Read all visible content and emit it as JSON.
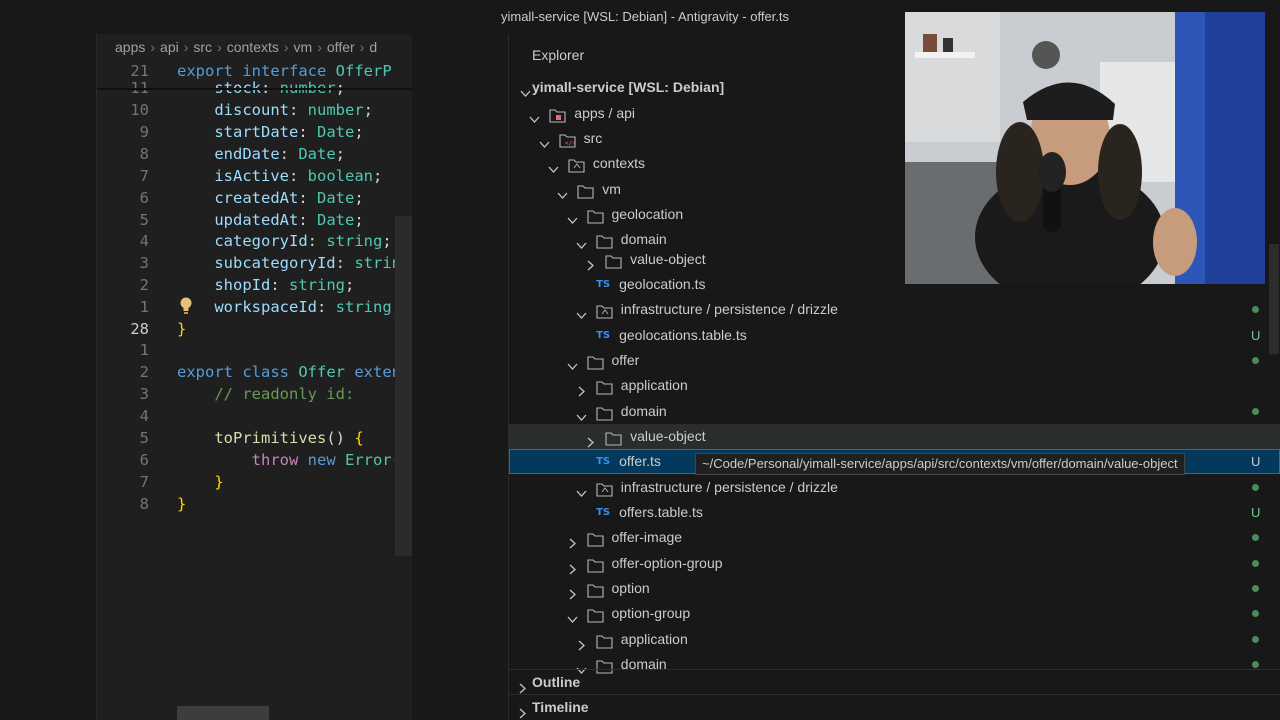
{
  "window": {
    "title": "yimall-service [WSL: Debian] - Antigravity - offer.ts"
  },
  "editor": {
    "breadcrumb": [
      "apps",
      "api",
      "src",
      "contexts",
      "vm",
      "offer",
      "d"
    ],
    "lines": [
      {
        "num": "21",
        "current": false,
        "tokens": [
          [
            "kw",
            "export "
          ],
          [
            "kw",
            "interface "
          ],
          [
            "ty",
            "OfferP"
          ]
        ]
      },
      {
        "num": "11",
        "current": false,
        "tokens": [
          [
            "pl",
            "    "
          ],
          [
            "pr",
            "stock"
          ],
          [
            "pl",
            ": "
          ],
          [
            "ty",
            "number"
          ],
          [
            "pl",
            ";"
          ]
        ]
      },
      {
        "num": "10",
        "current": false,
        "tokens": [
          [
            "pl",
            "    "
          ],
          [
            "pr",
            "discount"
          ],
          [
            "pl",
            ": "
          ],
          [
            "ty",
            "number"
          ],
          [
            "pl",
            ";"
          ]
        ]
      },
      {
        "num": "9",
        "current": false,
        "tokens": [
          [
            "pl",
            "    "
          ],
          [
            "pr",
            "startDate"
          ],
          [
            "pl",
            ": "
          ],
          [
            "ty",
            "Date"
          ],
          [
            "pl",
            ";"
          ]
        ]
      },
      {
        "num": "8",
        "current": false,
        "tokens": [
          [
            "pl",
            "    "
          ],
          [
            "pr",
            "endDate"
          ],
          [
            "pl",
            ": "
          ],
          [
            "ty",
            "Date"
          ],
          [
            "pl",
            ";"
          ]
        ]
      },
      {
        "num": "7",
        "current": false,
        "tokens": [
          [
            "pl",
            "    "
          ],
          [
            "pr",
            "isActive"
          ],
          [
            "pl",
            ": "
          ],
          [
            "ty",
            "boolean"
          ],
          [
            "pl",
            ";"
          ]
        ]
      },
      {
        "num": "6",
        "current": false,
        "tokens": [
          [
            "pl",
            "    "
          ],
          [
            "pr",
            "createdAt"
          ],
          [
            "pl",
            ": "
          ],
          [
            "ty",
            "Date"
          ],
          [
            "pl",
            ";"
          ]
        ]
      },
      {
        "num": "5",
        "current": false,
        "tokens": [
          [
            "pl",
            "    "
          ],
          [
            "pr",
            "updatedAt"
          ],
          [
            "pl",
            ": "
          ],
          [
            "ty",
            "Date"
          ],
          [
            "pl",
            ";"
          ]
        ]
      },
      {
        "num": "4",
        "current": false,
        "tokens": [
          [
            "pl",
            "    "
          ],
          [
            "pr",
            "categoryId"
          ],
          [
            "pl",
            ": "
          ],
          [
            "ty",
            "string"
          ],
          [
            "pl",
            ";"
          ]
        ]
      },
      {
        "num": "3",
        "current": false,
        "tokens": [
          [
            "pl",
            "    "
          ],
          [
            "pr",
            "subcategoryId"
          ],
          [
            "pl",
            ": "
          ],
          [
            "ty",
            "string"
          ],
          [
            "pl",
            ";"
          ]
        ]
      },
      {
        "num": "2",
        "current": false,
        "tokens": [
          [
            "pl",
            "    "
          ],
          [
            "pr",
            "shopId"
          ],
          [
            "pl",
            ": "
          ],
          [
            "ty",
            "string"
          ],
          [
            "pl",
            ";"
          ]
        ]
      },
      {
        "num": "1",
        "current": false,
        "tokens": [
          [
            "pl",
            "    "
          ],
          [
            "pr",
            "workspaceId"
          ],
          [
            "pl",
            ": "
          ],
          [
            "ty",
            "string"
          ],
          [
            "pl",
            ";"
          ]
        ]
      },
      {
        "num": "28",
        "current": true,
        "tokens": [
          [
            "br",
            "}"
          ]
        ]
      },
      {
        "num": "1",
        "current": false,
        "tokens": []
      },
      {
        "num": "2",
        "current": false,
        "tokens": [
          [
            "kw",
            "export "
          ],
          [
            "kw",
            "class "
          ],
          [
            "ty",
            "Offer "
          ],
          [
            "kw",
            "exten"
          ]
        ]
      },
      {
        "num": "3",
        "current": false,
        "tokens": [
          [
            "cm",
            "    // readonly id:"
          ]
        ]
      },
      {
        "num": "4",
        "current": false,
        "tokens": []
      },
      {
        "num": "5",
        "current": false,
        "tokens": [
          [
            "pl",
            "    "
          ],
          [
            "fn",
            "toPrimitives"
          ],
          [
            "pl",
            "() "
          ],
          [
            "br",
            "{"
          ]
        ]
      },
      {
        "num": "6",
        "current": false,
        "tokens": [
          [
            "pl",
            "        "
          ],
          [
            "kw2",
            "throw "
          ],
          [
            "kw",
            "new "
          ],
          [
            "ty",
            "Error"
          ],
          [
            "pl",
            "("
          ]
        ]
      },
      {
        "num": "7",
        "current": false,
        "tokens": [
          [
            "pl",
            "    "
          ],
          [
            "br",
            "}"
          ]
        ]
      },
      {
        "num": "8",
        "current": false,
        "tokens": [
          [
            "br",
            "}"
          ]
        ]
      }
    ]
  },
  "explorer": {
    "title": "Explorer",
    "tooltip": "~/Code/Personal/yimall-service/apps/api/src/contexts/vm/offer/domain/value-object",
    "rows": [
      {
        "type": "root",
        "label": "yimall-service [WSL: Debian]",
        "chev": "down",
        "depth": 0,
        "status": ""
      },
      {
        "type": "folder",
        "label": "apps / api",
        "chev": "down",
        "depth": 1,
        "status": "",
        "icon": "package"
      },
      {
        "type": "folder",
        "label": "src",
        "chev": "down",
        "depth": 2,
        "status": "",
        "icon": "src"
      },
      {
        "type": "folder",
        "label": "contexts",
        "chev": "down",
        "depth": 3,
        "status": "",
        "icon": "special"
      },
      {
        "type": "folder",
        "label": "vm",
        "chev": "down",
        "depth": 4,
        "status": "",
        "icon": "folder"
      },
      {
        "type": "folder",
        "label": "geolocation",
        "chev": "down",
        "depth": 5,
        "status": "",
        "icon": "folder"
      },
      {
        "type": "folder",
        "label": "domain",
        "chev": "down",
        "depth": 6,
        "status": "",
        "icon": "folder"
      },
      {
        "type": "folder",
        "label": "value-object",
        "chev": "right",
        "depth": 7,
        "status": "",
        "icon": "folder"
      },
      {
        "type": "file",
        "label": "geolocation.ts",
        "depth": 7,
        "status": "",
        "icon": "ts"
      },
      {
        "type": "folder",
        "label": "infrastructure / persistence / drizzle",
        "chev": "down",
        "depth": 6,
        "status": "dot",
        "icon": "special"
      },
      {
        "type": "file",
        "label": "geolocations.table.ts",
        "depth": 7,
        "status": "U",
        "icon": "ts"
      },
      {
        "type": "folder",
        "label": "offer",
        "chev": "down",
        "depth": 5,
        "status": "dot",
        "icon": "folder"
      },
      {
        "type": "folder",
        "label": "application",
        "chev": "right",
        "depth": 6,
        "status": "",
        "icon": "folder"
      },
      {
        "type": "folder",
        "label": "domain",
        "chev": "down",
        "depth": 6,
        "status": "dot",
        "icon": "folder"
      },
      {
        "type": "folder",
        "label": "value-object",
        "chev": "right",
        "depth": 7,
        "status": "",
        "icon": "folder",
        "hover": true
      },
      {
        "type": "file",
        "label": "offer.ts",
        "depth": 7,
        "status": "U",
        "icon": "ts",
        "selected": true
      },
      {
        "type": "folder",
        "label": "infrastructure / persistence / drizzle",
        "chev": "down",
        "depth": 6,
        "status": "dot",
        "icon": "special"
      },
      {
        "type": "file",
        "label": "offers.table.ts",
        "depth": 7,
        "status": "U",
        "icon": "ts"
      },
      {
        "type": "folder",
        "label": "offer-image",
        "chev": "right",
        "depth": 5,
        "status": "dot",
        "icon": "folder"
      },
      {
        "type": "folder",
        "label": "offer-option-group",
        "chev": "right",
        "depth": 5,
        "status": "dot",
        "icon": "folder"
      },
      {
        "type": "folder",
        "label": "option",
        "chev": "right",
        "depth": 5,
        "status": "dot",
        "icon": "folder"
      },
      {
        "type": "folder",
        "label": "option-group",
        "chev": "down",
        "depth": 5,
        "status": "dot",
        "icon": "folder"
      },
      {
        "type": "folder",
        "label": "application",
        "chev": "right",
        "depth": 6,
        "status": "dot",
        "icon": "folder"
      },
      {
        "type": "folder",
        "label": "domain",
        "chev": "down",
        "depth": 6,
        "status": "dot",
        "icon": "folder"
      }
    ],
    "sections": [
      {
        "label": "Outline"
      },
      {
        "label": "Timeline"
      }
    ]
  },
  "colors": {
    "accent": "#0078d4",
    "untracked": "#73c991",
    "selected_bg": "#04395e"
  }
}
